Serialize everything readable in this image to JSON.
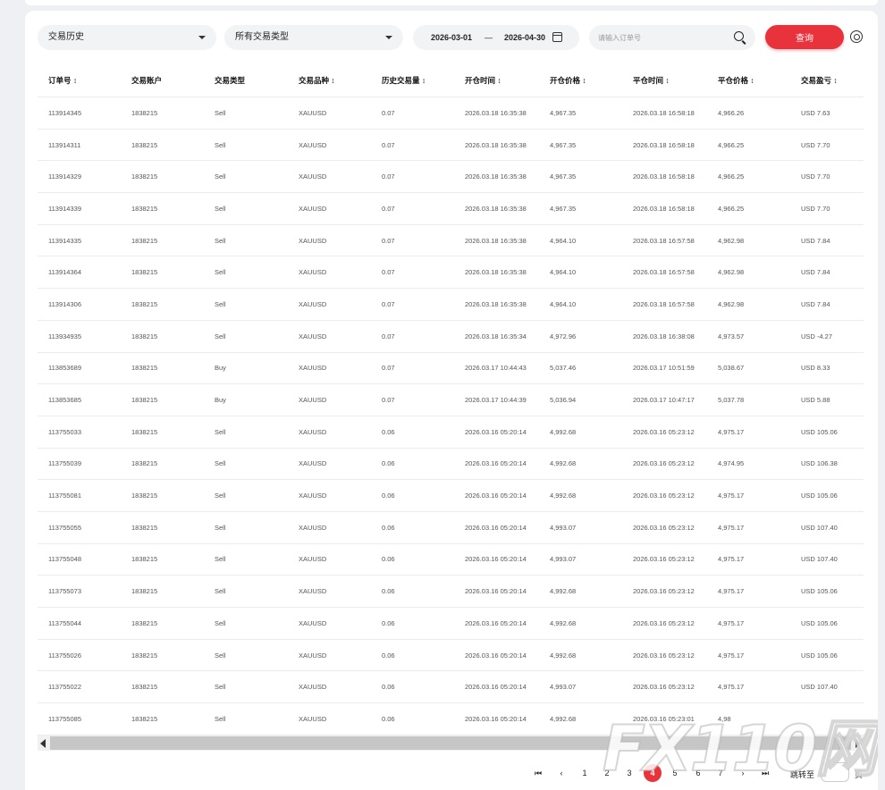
{
  "filters": {
    "history_select": "交易历史",
    "type_select": "所有交易类型",
    "date_from": "2026-03-01",
    "date_sep": "—",
    "date_to": "2026-04-30",
    "order_placeholder": "请输入订单号",
    "query_label": "查询"
  },
  "table": {
    "columns": [
      "订单号 ↕",
      "交易账户",
      "交易类型",
      "交易品种 ↕",
      "历史交易量 ↕",
      "开仓时间 ↕",
      "开仓价格 ↕",
      "平仓时间 ↕",
      "平仓价格 ↕",
      "交易盈亏 ↕"
    ],
    "rows": [
      [
        "113914345",
        "1838215",
        "Sell",
        "XAUUSD",
        "0.07",
        "2026.03.18 16:35:38",
        "4,967.35",
        "2026.03.18 16:58:18",
        "4,966.26",
        "USD 7.63"
      ],
      [
        "113914311",
        "1838215",
        "Sell",
        "XAUUSD",
        "0.07",
        "2026.03.18 16:35:38",
        "4,967.35",
        "2026.03.18 16:58:18",
        "4,966.25",
        "USD 7.70"
      ],
      [
        "113914329",
        "1838215",
        "Sell",
        "XAUUSD",
        "0.07",
        "2026.03.18 16:35:38",
        "4,967.35",
        "2026.03.18 16:58:18",
        "4,966.25",
        "USD 7.70"
      ],
      [
        "113914339",
        "1838215",
        "Sell",
        "XAUUSD",
        "0.07",
        "2026.03.18 16:35:38",
        "4,967.35",
        "2026.03.18 16:58:18",
        "4,966.25",
        "USD 7.70"
      ],
      [
        "113914335",
        "1838215",
        "Sell",
        "XAUUSD",
        "0.07",
        "2026.03.18 16:35:38",
        "4,964.10",
        "2026.03.18 16:57:58",
        "4,962.98",
        "USD 7.84"
      ],
      [
        "113914364",
        "1838215",
        "Sell",
        "XAUUSD",
        "0.07",
        "2026.03.18 16:35:38",
        "4,964.10",
        "2026.03.18 16:57:58",
        "4,962.98",
        "USD 7.84"
      ],
      [
        "113914306",
        "1838215",
        "Sell",
        "XAUUSD",
        "0.07",
        "2026.03.18 16:35:38",
        "4,964.10",
        "2026.03.18 16:57:58",
        "4,962.98",
        "USD 7.84"
      ],
      [
        "113934935",
        "1838215",
        "Sell",
        "XAUUSD",
        "0.07",
        "2026.03.18 16:35:34",
        "4,972.96",
        "2026.03.18 16:38:08",
        "4,973.57",
        "USD -4.27"
      ],
      [
        "113853689",
        "1838215",
        "Buy",
        "XAUUSD",
        "0.07",
        "2026.03.17 10:44:43",
        "5,037.46",
        "2026.03.17 10:51:59",
        "5,038.67",
        "USD 8.33"
      ],
      [
        "113853685",
        "1838215",
        "Buy",
        "XAUUSD",
        "0.07",
        "2026.03.17 10:44:39",
        "5,036.94",
        "2026.03.17 10:47:17",
        "5,037.78",
        "USD 5.88"
      ],
      [
        "113755033",
        "1838215",
        "Sell",
        "XAUUSD",
        "0.06",
        "2026.03.16 05:20:14",
        "4,992.68",
        "2026.03.16 05:23:12",
        "4,975.17",
        "USD 105.06"
      ],
      [
        "113755039",
        "1838215",
        "Sell",
        "XAUUSD",
        "0.06",
        "2026.03.16 05:20:14",
        "4,992.68",
        "2026.03.16 05:23:12",
        "4,974.95",
        "USD 106.38"
      ],
      [
        "113755081",
        "1838215",
        "Sell",
        "XAUUSD",
        "0.06",
        "2026.03.16 05:20:14",
        "4,992.68",
        "2026.03.16 05:23:12",
        "4,975.17",
        "USD 105.06"
      ],
      [
        "113755055",
        "1838215",
        "Sell",
        "XAUUSD",
        "0.06",
        "2026.03.16 05:20:14",
        "4,993.07",
        "2026.03.16 05:23:12",
        "4,975.17",
        "USD 107.40"
      ],
      [
        "113755048",
        "1838215",
        "Sell",
        "XAUUSD",
        "0.06",
        "2026.03.16 05:20:14",
        "4,993.07",
        "2026.03.16 05:23:12",
        "4,975.17",
        "USD 107.40"
      ],
      [
        "113755073",
        "1838215",
        "Sell",
        "XAUUSD",
        "0.06",
        "2026.03.16 05:20:14",
        "4,992.68",
        "2026.03.16 05:23:12",
        "4,975.17",
        "USD 105.06"
      ],
      [
        "113755044",
        "1838215",
        "Sell",
        "XAUUSD",
        "0.06",
        "2026.03.16 05:20:14",
        "4,992.68",
        "2026.03.16 05:23:12",
        "4,975.17",
        "USD 105.06"
      ],
      [
        "113755026",
        "1838215",
        "Sell",
        "XAUUSD",
        "0.06",
        "2026.03.16 05:20:14",
        "4,992.68",
        "2026.03.16 05:23:12",
        "4,975.17",
        "USD 105.06"
      ],
      [
        "113755022",
        "1838215",
        "Sell",
        "XAUUSD",
        "0.06",
        "2026.03.16 05:20:14",
        "4,993.07",
        "2026.03.16 05:23:12",
        "4,975.17",
        "USD 107.40"
      ],
      [
        "113755085",
        "1838215",
        "Sell",
        "XAUUSD",
        "0.06",
        "2026.03.16 05:20:14",
        "4,992.68",
        "2026.03.16 05:23:01",
        "4,98",
        ""
      ]
    ]
  },
  "pagination": {
    "first_icon": "first-page-icon",
    "prev_icon": "prev-page-icon",
    "pages": [
      "1",
      "2",
      "3",
      "4",
      "5",
      "6",
      "7"
    ],
    "current": "4",
    "next_icon": "next-page-icon",
    "last_icon": "last-page-icon",
    "jump_label": "跳转至",
    "page_suffix": "页"
  },
  "watermark": "FX110网",
  "colors": {
    "accent": "#e8323c",
    "background": "#eef0f4"
  }
}
